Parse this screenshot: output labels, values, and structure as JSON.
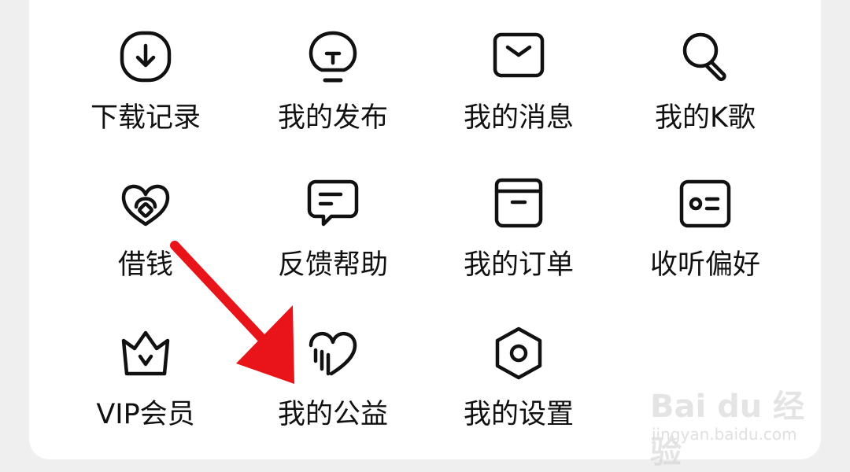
{
  "menu": {
    "items": [
      {
        "label": "下载记录",
        "icon": "download-icon"
      },
      {
        "label": "我的发布",
        "icon": "lightbulb-icon"
      },
      {
        "label": "我的消息",
        "icon": "mail-icon"
      },
      {
        "label": "我的K歌",
        "icon": "microphone-icon"
      },
      {
        "label": "借钱",
        "icon": "heart-coin-icon"
      },
      {
        "label": "反馈帮助",
        "icon": "chat-bubble-icon"
      },
      {
        "label": "我的订单",
        "icon": "box-icon"
      },
      {
        "label": "收听偏好",
        "icon": "id-card-icon"
      },
      {
        "label": "VIP会员",
        "icon": "crown-icon"
      },
      {
        "label": "我的公益",
        "icon": "charity-heart-icon"
      },
      {
        "label": "我的设置",
        "icon": "hexagon-gear-icon"
      }
    ]
  },
  "annotation": {
    "color": "#e8141a",
    "icon": "red-arrow"
  },
  "watermark": {
    "logo": "Bai du 经验",
    "url": "jingyan.baidu.com"
  }
}
